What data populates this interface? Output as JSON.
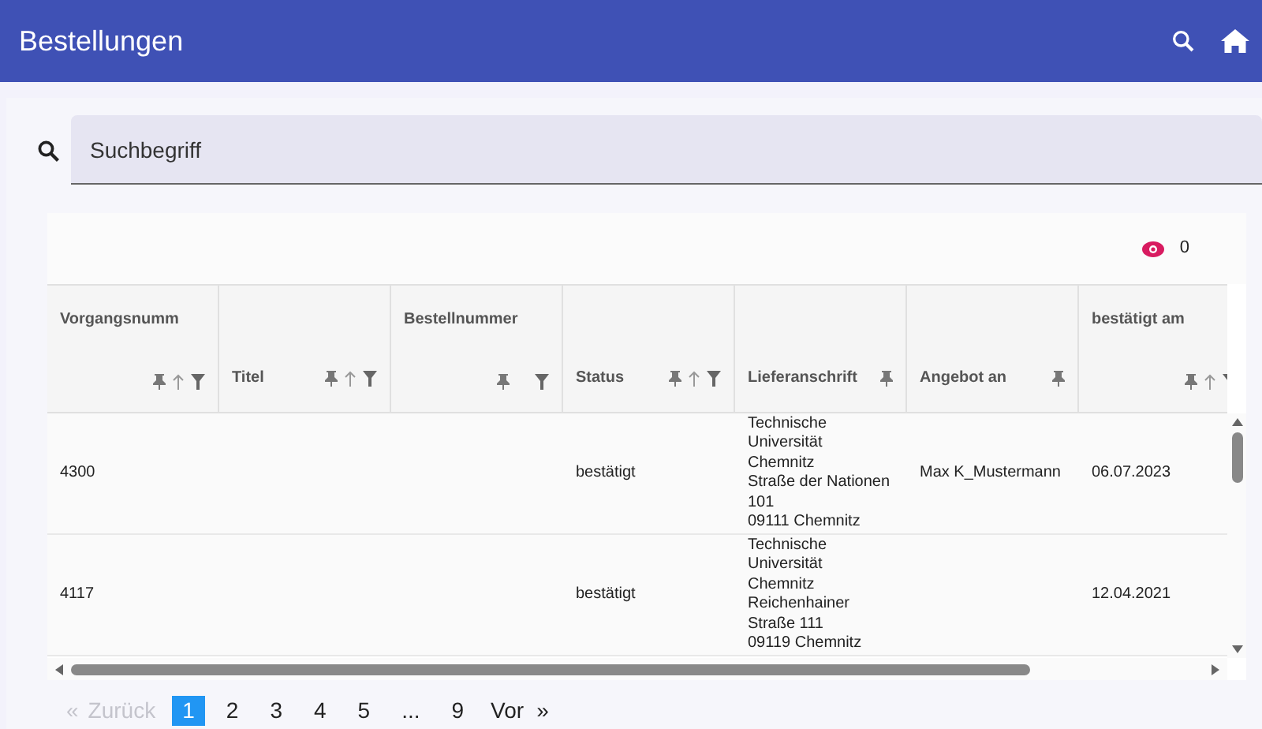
{
  "app_bar": {
    "title": "Bestellungen"
  },
  "search": {
    "placeholder": "Suchbegriff"
  },
  "toolbar": {
    "hidden_count": "0"
  },
  "table": {
    "columns": [
      {
        "label": "Vorgangsnumm",
        "kind": "top",
        "sortable": true,
        "filterable": true
      },
      {
        "label": "Titel",
        "kind": "bottom",
        "sortable": true,
        "filterable": true
      },
      {
        "label": "Bestellnummer",
        "kind": "top",
        "sortable": false,
        "filterable": true
      },
      {
        "label": "Status",
        "kind": "bottom",
        "sortable": true,
        "filterable": true
      },
      {
        "label": "Lieferanschrift",
        "kind": "bottom",
        "sortable": false,
        "filterable": false
      },
      {
        "label": "Angebot an",
        "kind": "bottom",
        "sortable": false,
        "filterable": false
      },
      {
        "label": "bestätigt am",
        "kind": "top",
        "sortable": true,
        "filterable": true
      }
    ],
    "rows": [
      {
        "cells": [
          [
            "4300"
          ],
          [],
          [],
          [
            "bestätigt"
          ],
          [
            "Technische",
            "Universität",
            "Chemnitz",
            "Straße der Nationen",
            "101",
            "09111 Chemnitz"
          ],
          [
            "Max K_Mustermann"
          ],
          [
            "06.07.2023"
          ]
        ]
      },
      {
        "cells": [
          [
            "4117"
          ],
          [],
          [],
          [
            "bestätigt"
          ],
          [
            "Technische",
            "Universität",
            "Chemnitz",
            "Reichenhainer",
            "Straße 111",
            "09119 Chemnitz"
          ],
          [],
          [
            "12.04.2021"
          ]
        ]
      }
    ]
  },
  "pagination": {
    "previous": {
      "label": "Zurück",
      "arrow": "«",
      "disabled": true
    },
    "pages": [
      {
        "label": "1",
        "selected": true
      },
      {
        "label": "2",
        "selected": false
      },
      {
        "label": "3",
        "selected": false
      },
      {
        "label": "4",
        "selected": false
      },
      {
        "label": "5",
        "selected": false
      },
      {
        "label": "...",
        "selected": false
      },
      {
        "label": "9",
        "selected": false
      }
    ],
    "next": {
      "label": "Vor",
      "arrow": "»",
      "disabled": false
    }
  }
}
